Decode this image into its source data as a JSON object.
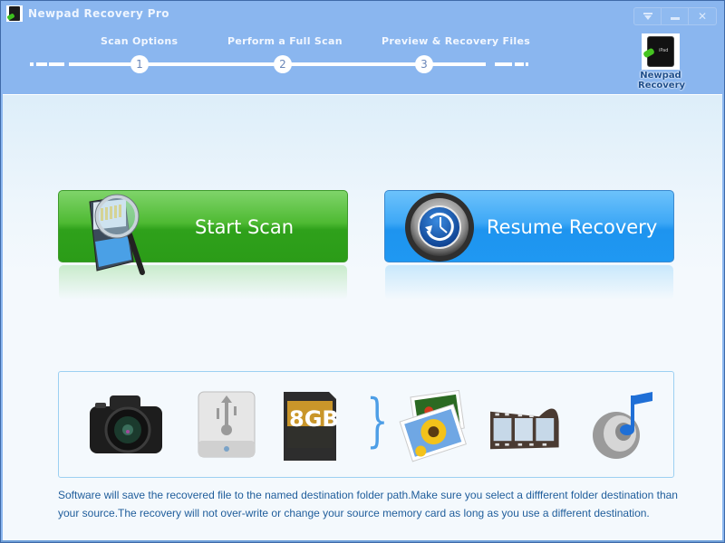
{
  "window": {
    "title": "Newpad Recovery Pro",
    "app_icon": "ipad-recovery-icon",
    "controls": [
      {
        "name": "menu-button",
        "icon": "dropdown-menu-icon"
      },
      {
        "name": "minimize-button",
        "icon": "minimize-icon"
      },
      {
        "name": "close-button",
        "icon": "close-icon",
        "glyph": "✕"
      }
    ]
  },
  "steps": [
    {
      "number": "1",
      "label": "Scan Options"
    },
    {
      "number": "2",
      "label": "Perform a Full Scan"
    },
    {
      "number": "3",
      "label": "Preview & Recovery Files"
    }
  ],
  "shortcut": {
    "line1": "Newpad",
    "line2": "Recovery",
    "thumb_text": "iPad"
  },
  "actions": {
    "start_scan": {
      "label": "Start Scan",
      "icon": "memory-card-magnifier-icon",
      "color": "#3aa923"
    },
    "resume_recovery": {
      "label": "Resume Recovery",
      "icon": "history-clock-icon",
      "color": "#2a9ef4"
    }
  },
  "devices": {
    "sources": [
      {
        "name": "camera",
        "icon": "camera-icon"
      },
      {
        "name": "usb-drive",
        "icon": "usb-drive-icon"
      },
      {
        "name": "sd-card",
        "icon": "sd-card-icon",
        "text": "8GB"
      }
    ],
    "brace": "}",
    "file_types": [
      {
        "name": "photos",
        "icon": "photo-icon"
      },
      {
        "name": "videos",
        "icon": "film-reel-icon"
      },
      {
        "name": "audio",
        "icon": "music-speaker-icon"
      }
    ]
  },
  "notice": "Software will save the recovered file to the named destination folder path.Make sure you select a diffferent folder destination than your source.The recovery will not over-write or change your source memory card as long as you use a different destination."
}
